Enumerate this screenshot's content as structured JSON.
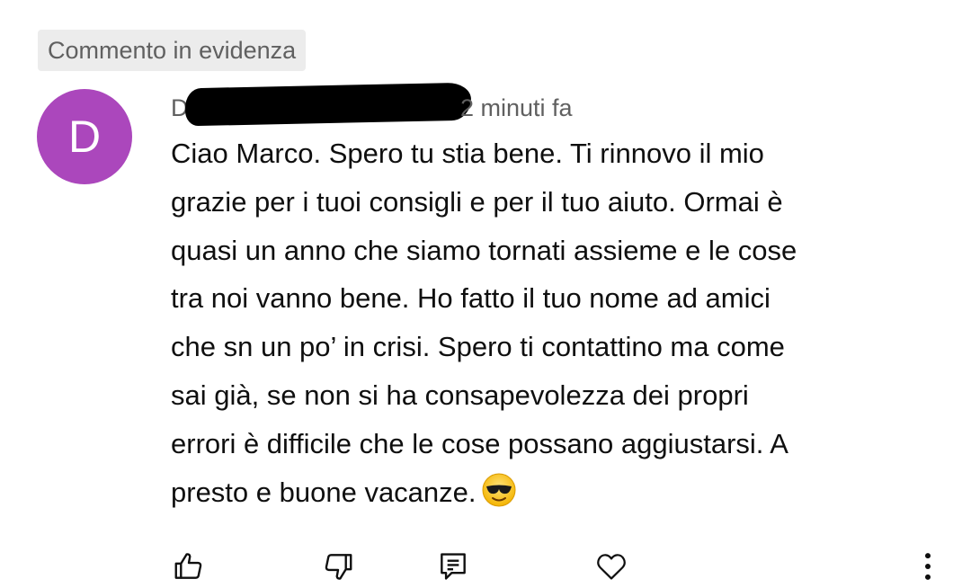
{
  "comment": {
    "pinned_label": "Commento in evidenza",
    "avatar_letter": "D",
    "avatar_color": "#ab47bc",
    "author_visible": "D",
    "timestamp": "2 minuti fa",
    "lines": [
      "Ciao Marco. Spero tu stia bene. Ti rinnovo il mio",
      "grazie per i tuoi consigli e per il tuo aiuto. Ormai è",
      "quasi un anno che siamo tornati assieme e le cose",
      "tra noi vanno bene. Ho fatto il tuo nome ad amici",
      "che sn un po’ in crisi. Spero ti contattino ma come",
      "sai già, se non si ha consapevolezza dei propri",
      "errori è difficile che le cose possano aggiustarsi. A",
      "presto e buone vacanze."
    ],
    "emoji": "smiling-face-with-sunglasses"
  },
  "actions": {
    "like_icon": "thumb-up-icon",
    "dislike_icon": "thumb-down-icon",
    "reply_icon": "reply-comment-icon",
    "heart_icon": "heart-icon",
    "more_icon": "more-vertical-icon"
  }
}
